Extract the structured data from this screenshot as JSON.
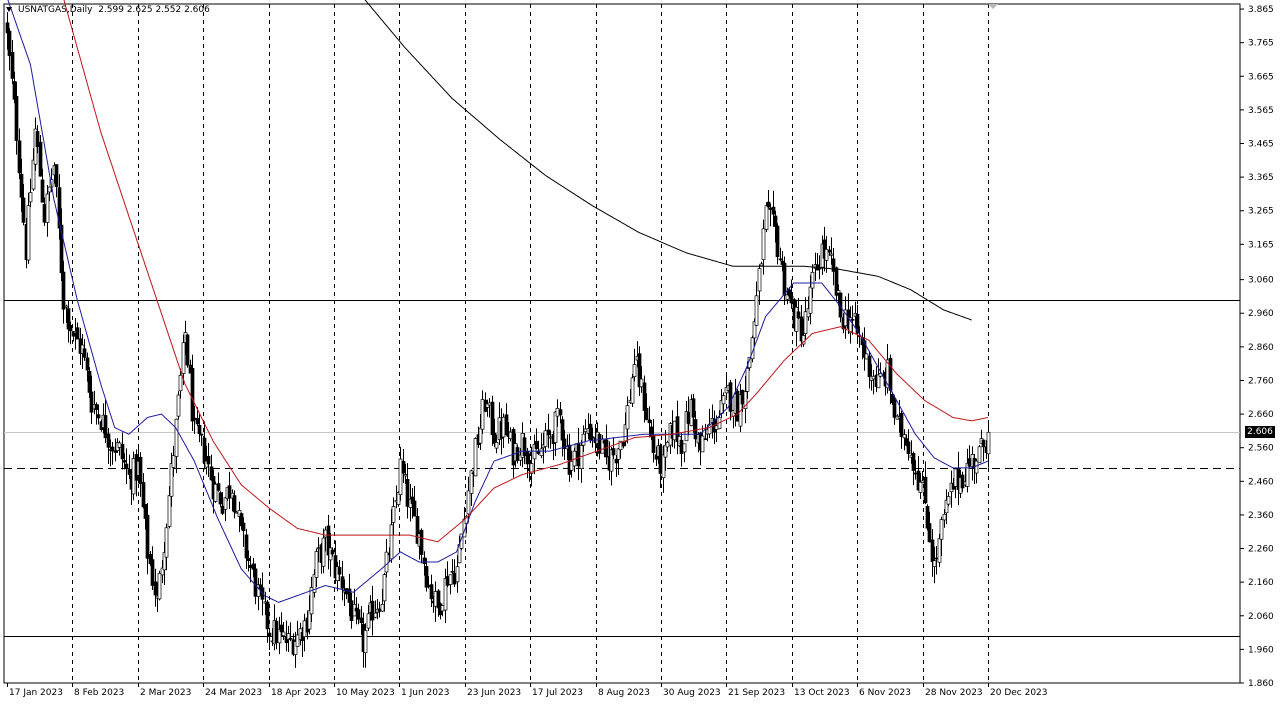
{
  "header": {
    "symbol": "USNATGAS,Daily",
    "ohlc": "2.599 2.625 2.552 2.606"
  },
  "current_price_label": "2.606",
  "chart_data": {
    "type": "candlestick",
    "symbol": "USNATGAS",
    "timeframe": "Daily",
    "ylim": [
      1.86,
      3.88
    ],
    "y_ticks": [
      "3.865",
      "3.765",
      "3.665",
      "3.565",
      "3.465",
      "3.365",
      "3.265",
      "3.165",
      "3.060",
      "2.960",
      "2.860",
      "2.760",
      "2.660",
      "2.560",
      "2.460",
      "2.360",
      "2.260",
      "2.160",
      "2.060",
      "1.960",
      "1.860"
    ],
    "x_ticks": [
      "17 Jan 2023",
      "8 Feb 2023",
      "2 Mar 2023",
      "24 Mar 2023",
      "18 Apr 2023",
      "10 May 2023",
      "1 Jun 2023",
      "23 Jun 2023",
      "17 Jul 2023",
      "8 Aug 2023",
      "30 Aug 2023",
      "21 Sep 2023",
      "13 Oct 2023",
      "6 Nov 2023",
      "28 Nov 2023",
      "20 Dec 2023"
    ],
    "horizontal_lines": [
      {
        "price": 3.0,
        "style": "solid"
      },
      {
        "price": 2.5,
        "style": "dashed"
      },
      {
        "price": 2.0,
        "style": "solid"
      },
      {
        "price": 2.606,
        "style": "solid-light"
      }
    ],
    "last_price": 2.606,
    "close_path": [
      [
        0,
        3.78
      ],
      [
        4,
        3.5
      ],
      [
        8,
        3.15
      ],
      [
        12,
        3.5
      ],
      [
        16,
        3.25
      ],
      [
        20,
        3.4
      ],
      [
        24,
        3.0
      ],
      [
        28,
        2.9
      ],
      [
        32,
        2.85
      ],
      [
        36,
        2.7
      ],
      [
        40,
        2.65
      ],
      [
        44,
        2.58
      ],
      [
        48,
        2.55
      ],
      [
        52,
        2.47
      ],
      [
        56,
        2.5
      ],
      [
        60,
        2.25
      ],
      [
        64,
        2.1
      ],
      [
        68,
        2.35
      ],
      [
        72,
        2.62
      ],
      [
        76,
        2.9
      ],
      [
        80,
        2.6
      ],
      [
        84,
        2.55
      ],
      [
        88,
        2.45
      ],
      [
        92,
        2.4
      ],
      [
        96,
        2.45
      ],
      [
        100,
        2.3
      ],
      [
        104,
        2.2
      ],
      [
        108,
        2.1
      ],
      [
        112,
        2.02
      ],
      [
        116,
        2.0
      ],
      [
        120,
        1.98
      ],
      [
        124,
        2.0
      ],
      [
        128,
        2.05
      ],
      [
        132,
        2.22
      ],
      [
        136,
        2.28
      ],
      [
        140,
        2.2
      ],
      [
        144,
        2.15
      ],
      [
        148,
        2.05
      ],
      [
        152,
        1.98
      ],
      [
        156,
        2.08
      ],
      [
        160,
        2.12
      ],
      [
        164,
        2.3
      ],
      [
        168,
        2.5
      ],
      [
        172,
        2.38
      ],
      [
        176,
        2.3
      ],
      [
        180,
        2.15
      ],
      [
        184,
        2.08
      ],
      [
        188,
        2.18
      ],
      [
        192,
        2.2
      ],
      [
        196,
        2.4
      ],
      [
        200,
        2.55
      ],
      [
        204,
        2.7
      ],
      [
        208,
        2.6
      ],
      [
        212,
        2.62
      ],
      [
        216,
        2.55
      ],
      [
        220,
        2.58
      ],
      [
        224,
        2.52
      ],
      [
        228,
        2.55
      ],
      [
        232,
        2.6
      ],
      [
        236,
        2.65
      ],
      [
        240,
        2.52
      ],
      [
        244,
        2.55
      ],
      [
        248,
        2.62
      ],
      [
        252,
        2.58
      ],
      [
        256,
        2.52
      ],
      [
        260,
        2.55
      ],
      [
        264,
        2.62
      ],
      [
        268,
        2.82
      ],
      [
        272,
        2.7
      ],
      [
        276,
        2.55
      ],
      [
        280,
        2.5
      ],
      [
        284,
        2.62
      ],
      [
        288,
        2.58
      ],
      [
        292,
        2.68
      ],
      [
        296,
        2.55
      ],
      [
        300,
        2.62
      ],
      [
        304,
        2.65
      ],
      [
        308,
        2.72
      ],
      [
        312,
        2.68
      ],
      [
        316,
        2.78
      ],
      [
        320,
        3.0
      ],
      [
        324,
        3.25
      ],
      [
        328,
        3.2
      ],
      [
        332,
        3.05
      ],
      [
        336,
        2.95
      ],
      [
        340,
        2.9
      ],
      [
        344,
        3.05
      ],
      [
        348,
        3.15
      ],
      [
        352,
        3.1
      ],
      [
        356,
        2.95
      ],
      [
        360,
        2.95
      ],
      [
        364,
        2.88
      ],
      [
        368,
        2.8
      ],
      [
        372,
        2.75
      ],
      [
        376,
        2.78
      ],
      [
        380,
        2.62
      ],
      [
        384,
        2.6
      ],
      [
        388,
        2.5
      ],
      [
        392,
        2.4
      ],
      [
        396,
        2.2
      ],
      [
        400,
        2.35
      ],
      [
        404,
        2.45
      ],
      [
        408,
        2.48
      ],
      [
        412,
        2.52
      ],
      [
        416,
        2.55
      ],
      [
        419,
        2.606
      ]
    ],
    "moving_averages": [
      {
        "color": "#1c1ca0",
        "path": [
          [
            0,
            3.9
          ],
          [
            10,
            3.7
          ],
          [
            20,
            3.3
          ],
          [
            30,
            3.0
          ],
          [
            40,
            2.75
          ],
          [
            46,
            2.62
          ],
          [
            52,
            2.6
          ],
          [
            60,
            2.65
          ],
          [
            66,
            2.66
          ],
          [
            72,
            2.62
          ],
          [
            80,
            2.52
          ],
          [
            90,
            2.35
          ],
          [
            100,
            2.2
          ],
          [
            110,
            2.12
          ],
          [
            116,
            2.1
          ],
          [
            124,
            2.12
          ],
          [
            136,
            2.15
          ],
          [
            148,
            2.13
          ],
          [
            160,
            2.2
          ],
          [
            168,
            2.25
          ],
          [
            176,
            2.22
          ],
          [
            184,
            2.22
          ],
          [
            192,
            2.25
          ],
          [
            200,
            2.4
          ],
          [
            208,
            2.52
          ],
          [
            220,
            2.55
          ],
          [
            232,
            2.55
          ],
          [
            248,
            2.58
          ],
          [
            260,
            2.59
          ],
          [
            272,
            2.6
          ],
          [
            284,
            2.6
          ],
          [
            296,
            2.6
          ],
          [
            308,
            2.68
          ],
          [
            316,
            2.8
          ],
          [
            324,
            2.95
          ],
          [
            336,
            3.05
          ],
          [
            348,
            3.05
          ],
          [
            356,
            2.98
          ],
          [
            364,
            2.9
          ],
          [
            372,
            2.8
          ],
          [
            380,
            2.7
          ],
          [
            388,
            2.6
          ],
          [
            396,
            2.53
          ],
          [
            404,
            2.5
          ],
          [
            412,
            2.5
          ],
          [
            419,
            2.52
          ]
        ]
      },
      {
        "color": "#c0161a",
        "path": [
          [
            24,
            3.9
          ],
          [
            40,
            3.5
          ],
          [
            52,
            3.25
          ],
          [
            64,
            3.0
          ],
          [
            76,
            2.75
          ],
          [
            88,
            2.58
          ],
          [
            100,
            2.45
          ],
          [
            112,
            2.38
          ],
          [
            124,
            2.32
          ],
          [
            136,
            2.3
          ],
          [
            148,
            2.3
          ],
          [
            160,
            2.3
          ],
          [
            172,
            2.3
          ],
          [
            184,
            2.28
          ],
          [
            196,
            2.35
          ],
          [
            208,
            2.44
          ],
          [
            220,
            2.48
          ],
          [
            236,
            2.51
          ],
          [
            252,
            2.55
          ],
          [
            268,
            2.59
          ],
          [
            284,
            2.6
          ],
          [
            300,
            2.62
          ],
          [
            312,
            2.66
          ],
          [
            320,
            2.72
          ],
          [
            332,
            2.82
          ],
          [
            344,
            2.9
          ],
          [
            356,
            2.92
          ],
          [
            368,
            2.88
          ],
          [
            380,
            2.78
          ],
          [
            392,
            2.7
          ],
          [
            404,
            2.65
          ],
          [
            412,
            2.64
          ],
          [
            419,
            2.65
          ]
        ]
      },
      {
        "color": "#000000",
        "path": [
          [
            152,
            3.9
          ],
          [
            170,
            3.75
          ],
          [
            190,
            3.6
          ],
          [
            210,
            3.48
          ],
          [
            230,
            3.37
          ],
          [
            250,
            3.28
          ],
          [
            270,
            3.2
          ],
          [
            290,
            3.14
          ],
          [
            310,
            3.1
          ],
          [
            326,
            3.1
          ],
          [
            340,
            3.1
          ],
          [
            356,
            3.09
          ],
          [
            372,
            3.07
          ],
          [
            386,
            3.03
          ],
          [
            400,
            2.97
          ],
          [
            412,
            2.94
          ]
        ]
      }
    ]
  }
}
